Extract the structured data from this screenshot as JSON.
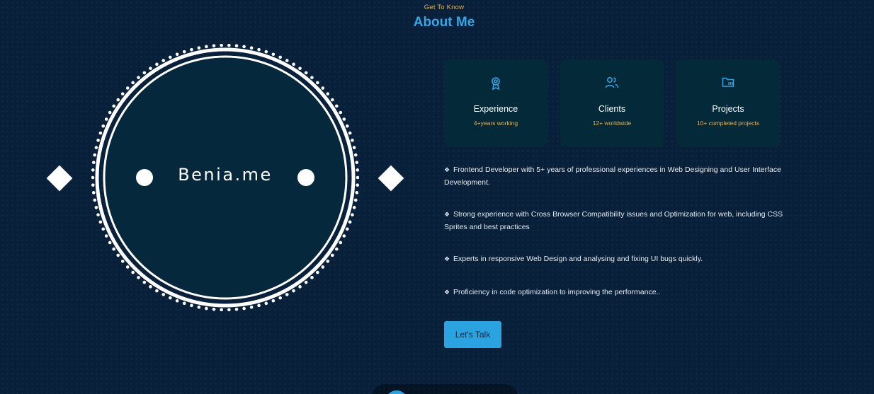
{
  "header": {
    "eyebrow": "Get To Know",
    "title": "About Me"
  },
  "hero": {
    "brand": "Benia.me"
  },
  "cards": [
    {
      "icon": "award-icon",
      "title": "Experience",
      "subtitle": "4+years working"
    },
    {
      "icon": "users-icon",
      "title": "Clients",
      "subtitle": "12+ worldwide"
    },
    {
      "icon": "folder-icon",
      "title": "Projects",
      "subtitle": "10+ completed projects"
    }
  ],
  "bullets": [
    {
      "mark": "❖",
      "text": "Frontend Developer with 5+ years of professional experiences in Web Designing and User Interface Development."
    },
    {
      "mark": "❖",
      "text": "Strong experience with Cross Browser Compatibility issues and Optimization for web, including CSS Sprites and best practices"
    },
    {
      "mark": "❖",
      "text": "Experts in responsive Web Design and analysing and fixing UI bugs quickly."
    },
    {
      "mark": "❖",
      "text": "Proficiency in code optimization to improving the performance.."
    }
  ],
  "cta": {
    "label": "Let's Talk"
  },
  "colors": {
    "background": "#08203a",
    "accent": "#2aa3e0",
    "heading": "#36a6e6",
    "gold": "#e2b261",
    "card": "#042938",
    "dial_fill": "#06283c"
  }
}
